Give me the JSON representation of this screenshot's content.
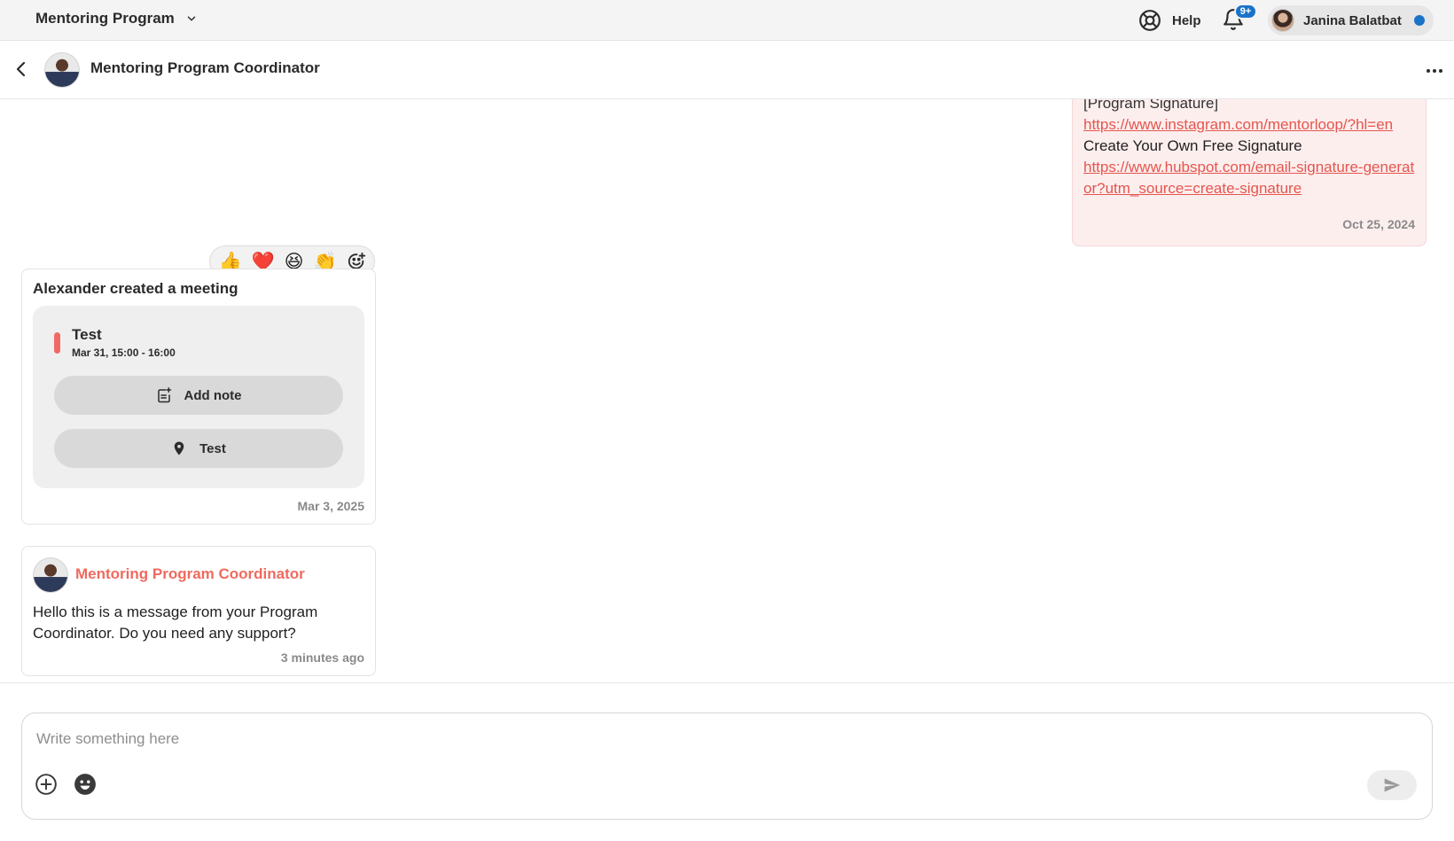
{
  "topbar": {
    "program_name": "Mentoring Program",
    "help_label": "Help",
    "notifications_badge": "9+",
    "user_name": "Janina Balatbat"
  },
  "conversation": {
    "title": "Mentoring Program Coordinator"
  },
  "messages": {
    "own": {
      "cut_line": "[Program Signature]",
      "link1": "https://www.instagram.com/mentorloop/?hl=en",
      "plain": "Create Your Own Free Signature",
      "link2": "https://www.hubspot.com/email-signature-generator?utm_source=create-signature",
      "timestamp": "Oct 25, 2024"
    },
    "reactions": [
      "👍",
      "❤️",
      "😆",
      "👏"
    ],
    "meeting": {
      "created_text": "Alexander created a meeting",
      "title": "Test",
      "time": "Mar 31, 15:00 - 16:00",
      "add_note_label": "Add note",
      "location_label": "Test",
      "timestamp": "Mar 3, 2025"
    },
    "coordinator": {
      "sender": "Mentoring Program Coordinator",
      "body": "Hello this is a message from your Program Coordinator. Do you need any support?",
      "timestamp": "3 minutes ago"
    }
  },
  "composer": {
    "placeholder": "Write something here"
  },
  "icons": {
    "program_switch": "chevron-down-icon",
    "help": "lifebuoy-icon",
    "notifications": "bell-icon",
    "back": "chevron-left-icon",
    "more": "more-horizontal-icon",
    "add_reaction": "add-emoji-icon",
    "add_note": "note-add-icon",
    "location": "map-pin-icon",
    "attach": "plus-circle-icon",
    "emoji": "emoji-icon",
    "send": "send-icon"
  },
  "colors": {
    "accent": "#ef6a5f",
    "link": "#e4564e",
    "badge": "#1b73c9",
    "own_bubble": "#fdeeee"
  }
}
